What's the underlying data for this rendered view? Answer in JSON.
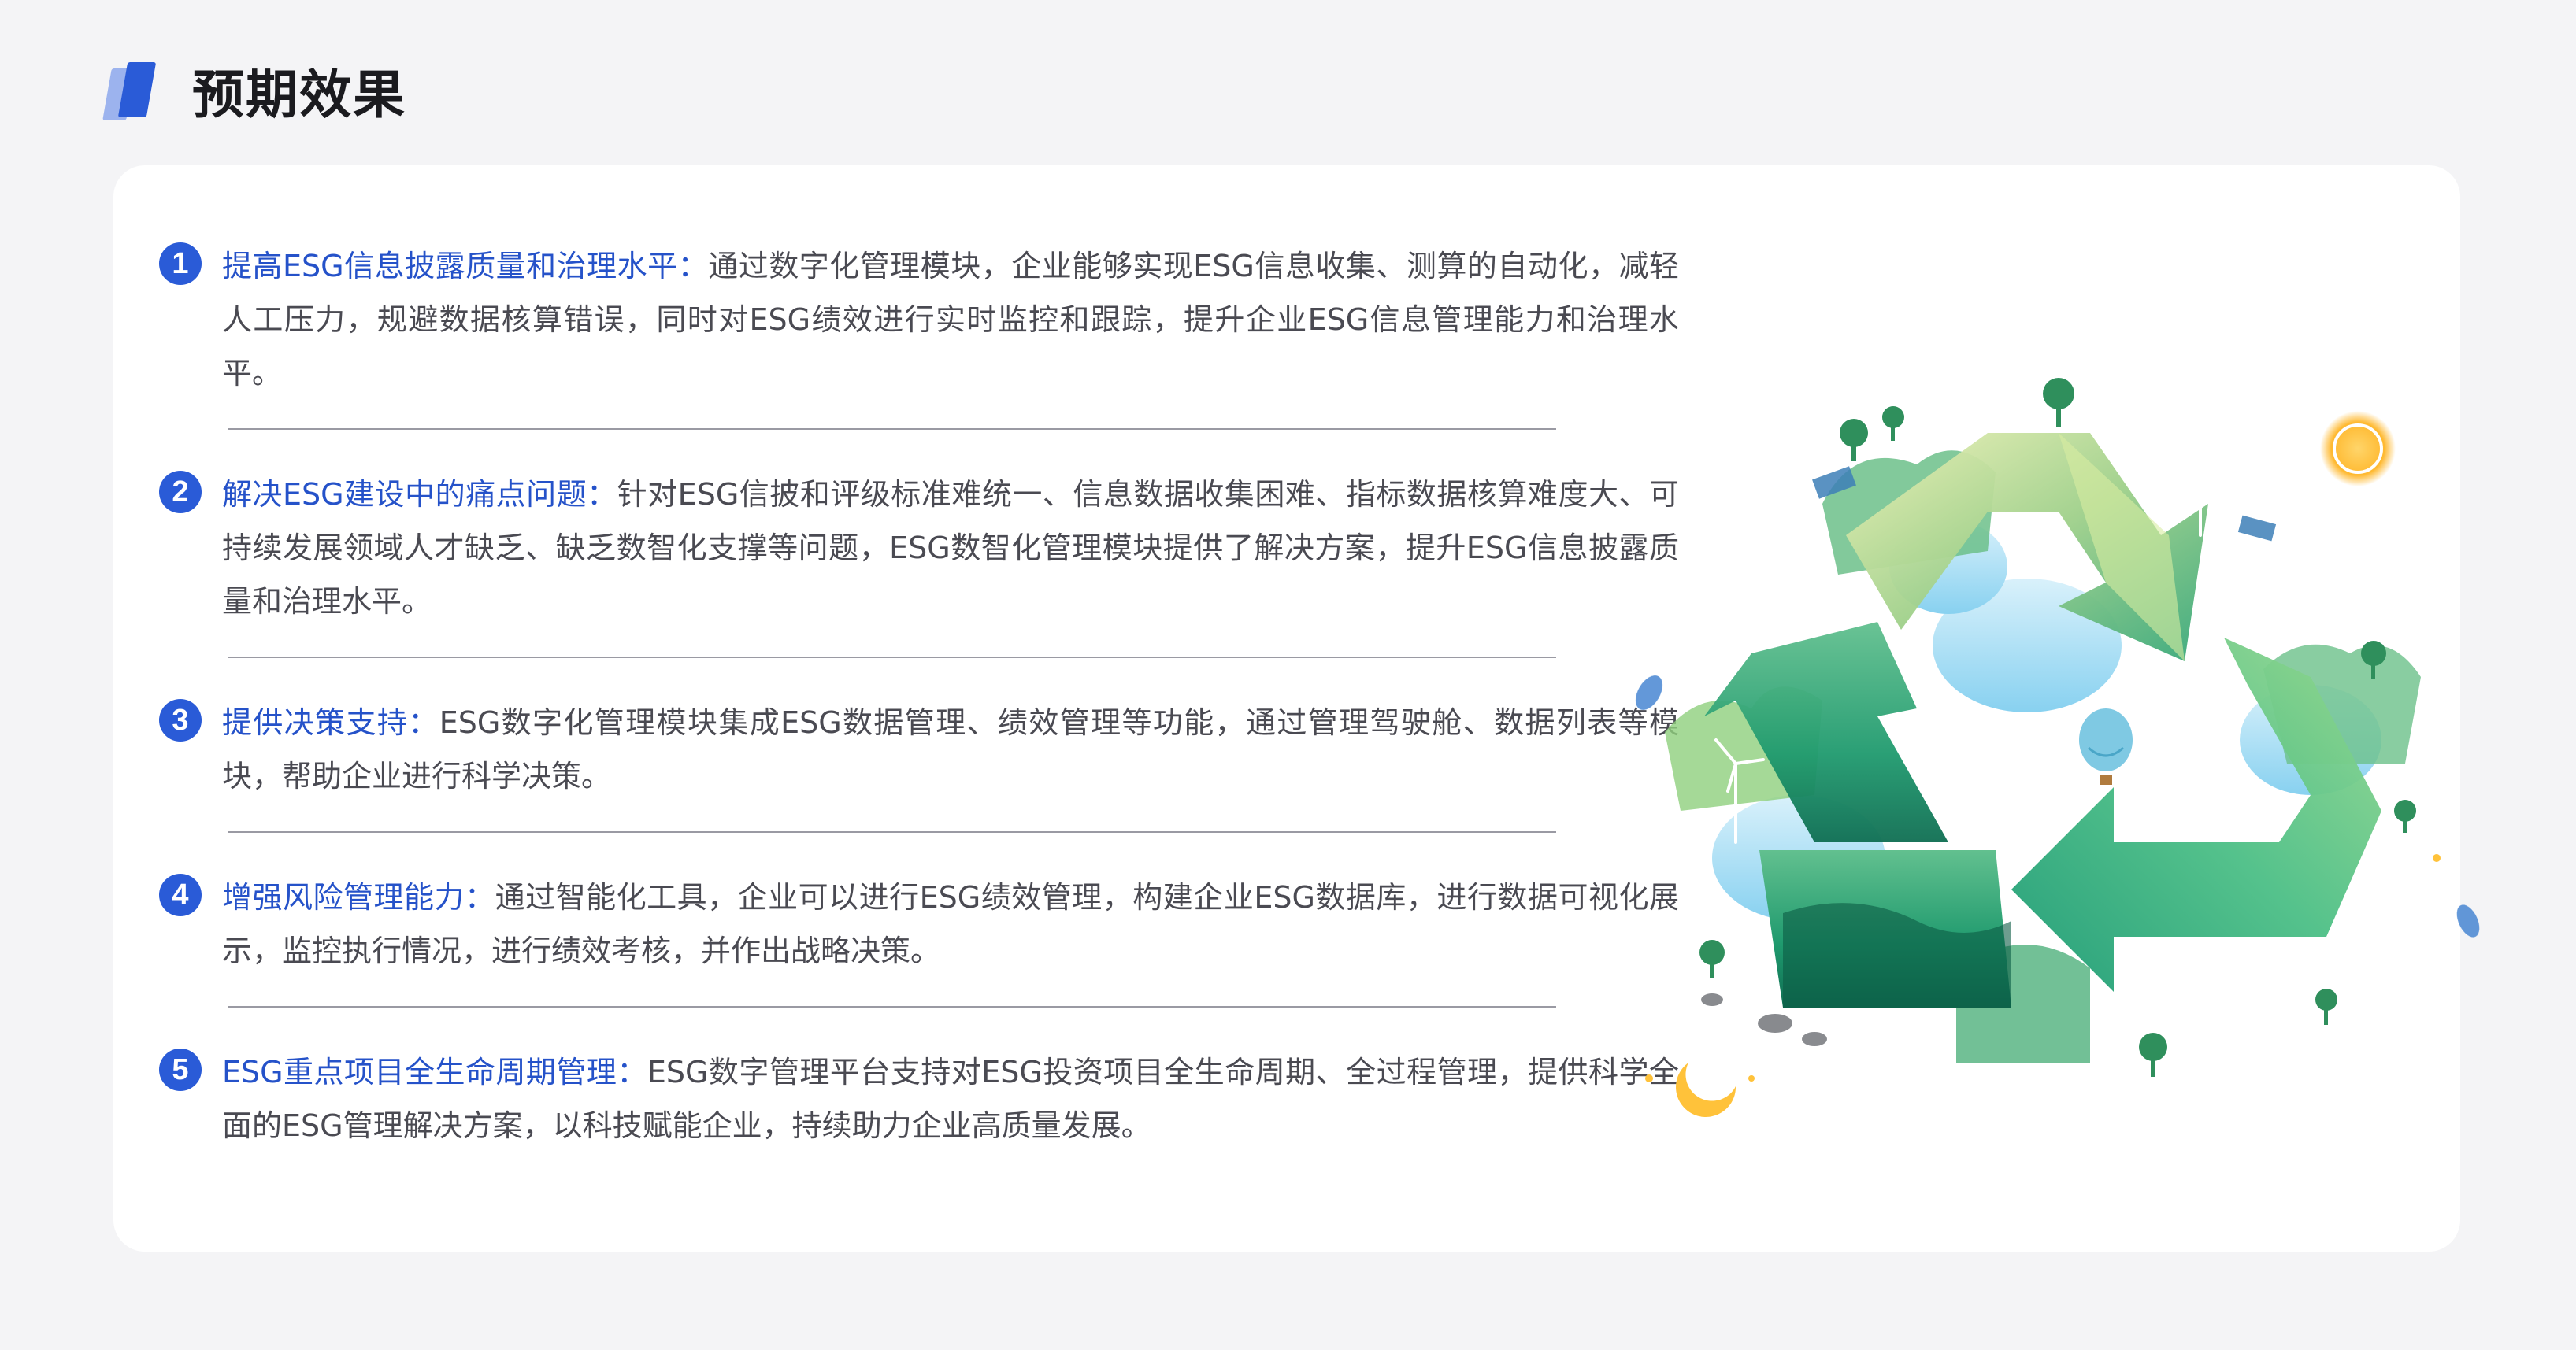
{
  "header": {
    "title": "预期效果"
  },
  "items": [
    {
      "number": "1",
      "heading": "提高ESG信息披露质量和治理水平：",
      "body": "通过数字化管理模块，企业能够实现ESG信息收集、测算的自动化，减轻人工压力，规避数据核算错误，同时对ESG绩效进行实时监控和跟踪，提升企业ESG信息管理能力和治理水平。"
    },
    {
      "number": "2",
      "heading": "解决ESG建设中的痛点问题：",
      "body": "针对ESG信披和评级标准难统一、信息数据收集困难、指标数据核算难度大、可持续发展领域人才缺乏、缺乏数智化支撑等问题，ESG数智化管理模块提供了解决方案，提升ESG信息披露质量和治理水平。"
    },
    {
      "number": "3",
      "heading": "提供决策支持：",
      "body": "ESG数字化管理模块集成ESG数据管理、绩效管理等功能，通过管理驾驶舱、数据列表等模块，帮助企业进行科学决策。"
    },
    {
      "number": "4",
      "heading": "增强风险管理能力：",
      "body": "通过智能化工具，企业可以进行ESG绩效管理，构建企业ESG数据库，进行数据可视化展示，监控执行情况，进行绩效考核，并作出战略决策。"
    },
    {
      "number": "5",
      "heading": "ESG重点项目全生命周期管理：",
      "body": "ESG数字管理平台支持对ESG投资项目全生命周期、全过程管理，提供科学全面的ESG管理解决方案，以科技赋能企业，持续助力企业高质量发展。"
    }
  ],
  "colors": {
    "accent": "#2a5bd7",
    "heading_text": "#2552c9",
    "body_text": "#4a4a52",
    "background": "#f4f4f6",
    "card": "#ffffff"
  },
  "icons": {
    "header": "logo-bars-icon",
    "illustration": "recycle-icon"
  }
}
